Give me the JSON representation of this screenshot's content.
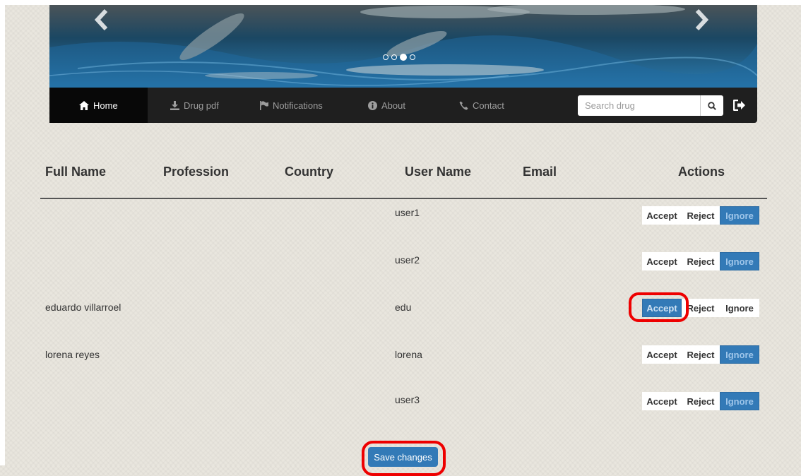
{
  "carousel": {
    "prev_icon": "chevron-left-icon",
    "next_icon": "chevron-right-icon",
    "slide_count": 4,
    "active_slide": 3
  },
  "nav": {
    "items": [
      {
        "label": "Home",
        "icon": "home-icon",
        "active": true
      },
      {
        "label": "Drug pdf",
        "icon": "download-icon"
      },
      {
        "label": "Notifications",
        "icon": "flag-icon"
      },
      {
        "label": "About",
        "icon": "info-icon"
      },
      {
        "label": "Contact",
        "icon": "phone-icon"
      }
    ],
    "search_placeholder": "Search drug",
    "search_icon": "search-icon",
    "logout_icon": "logout-icon"
  },
  "table": {
    "headers": [
      "Full Name",
      "Profession",
      "Country",
      "User Name",
      "Email",
      "Actions"
    ],
    "action_labels": {
      "accept": "Accept",
      "reject": "Reject",
      "ignore": "Ignore"
    },
    "rows": [
      {
        "full_name": "",
        "profession": "",
        "country": "",
        "user_name": "user1",
        "email": "",
        "selected": "ignore"
      },
      {
        "full_name": "",
        "profession": "",
        "country": "",
        "user_name": "user2",
        "email": "",
        "selected": "ignore"
      },
      {
        "full_name": "eduardo villarroel",
        "profession": "",
        "country": "",
        "user_name": "edu",
        "email": "",
        "selected": "accept"
      },
      {
        "full_name": "lorena reyes",
        "profession": "",
        "country": "",
        "user_name": "lorena",
        "email": "",
        "selected": "ignore"
      },
      {
        "full_name": "",
        "profession": "",
        "country": "",
        "user_name": "user3",
        "email": "",
        "selected": "ignore"
      }
    ]
  },
  "save_label": "Save changes",
  "colors": {
    "primary": "#337ab7",
    "navbar": "#1f1f1f",
    "highlight": "#ee0000"
  }
}
